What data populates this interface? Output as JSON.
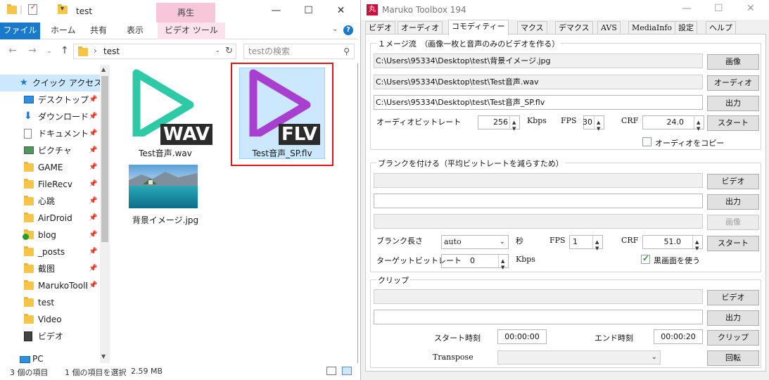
{
  "explorer": {
    "title": "test",
    "ribbon_context_tab": "再生",
    "tabs": [
      "ファイル",
      "ホーム",
      "共有",
      "表示",
      "ビデオ ツール"
    ],
    "address_path": "test",
    "search_placeholder": "testの検索",
    "nav": {
      "quick_access": "クイック アクセス",
      "items": [
        {
          "label": "デスクトップ",
          "icon": "desktop-icon",
          "pinned": true
        },
        {
          "label": "ダウンロード",
          "icon": "download-icon",
          "pinned": true
        },
        {
          "label": "ドキュメント",
          "icon": "document-icon",
          "pinned": true
        },
        {
          "label": "ピクチャ",
          "icon": "pictures-icon",
          "pinned": true
        },
        {
          "label": "GAME",
          "icon": "folder-icon",
          "pinned": true
        },
        {
          "label": "FileRecv",
          "icon": "folder-icon",
          "pinned": true
        },
        {
          "label": "心跳",
          "icon": "folder-icon",
          "pinned": true
        },
        {
          "label": "AirDroid",
          "icon": "folder-icon",
          "pinned": true
        },
        {
          "label": "blog",
          "icon": "folder-icon",
          "pinned": true
        },
        {
          "label": "_posts",
          "icon": "folder-icon",
          "pinned": true
        },
        {
          "label": "截图",
          "icon": "folder-icon",
          "pinned": true
        },
        {
          "label": "MarukoToolB",
          "icon": "folder-icon",
          "pinned": true
        },
        {
          "label": "test",
          "icon": "folder-icon",
          "pinned": false
        },
        {
          "label": "Video",
          "icon": "folder-icon",
          "pinned": false
        },
        {
          "label": "ビデオ",
          "icon": "video-folder-icon",
          "pinned": false
        }
      ],
      "pc": "PC"
    },
    "files": [
      {
        "name": "Test音声.wav",
        "badge": "WAV",
        "color": "#2ec9a7"
      },
      {
        "name": "Test音声_SP.flv",
        "badge": "FLV",
        "color": "#a93fd1",
        "selected": true
      },
      {
        "name": "背景イメージ.jpg",
        "badge": "",
        "color": ""
      }
    ],
    "status": {
      "count": "3 個の項目",
      "selection": "1 個の項目を選択",
      "size": "2.59 MB"
    }
  },
  "maruko": {
    "title": "Maruko Toolbox 194",
    "logo": "丸",
    "tabs": [
      "ビデオ",
      "オーディオ",
      "コモディティー",
      "マクス",
      "デマクス",
      "AVS",
      "MediaInfo",
      "設定",
      "ヘルプ"
    ],
    "active_tab": "コモディティー",
    "image_stream": {
      "title": "１メージ流　（画像一枚と音声のみのビデオを作る）",
      "image_path": "C:\\Users\\95334\\Desktop\\test\\背景イメージ.jpg",
      "audio_path": "C:\\Users\\95334\\Desktop\\test\\Test音声.wav",
      "output_path": "C:\\Users\\95334\\Desktop\\test\\Test音声_SP.flv",
      "btn_image": "画像",
      "btn_audio": "オーディオ",
      "btn_output": "出力",
      "btn_start": "スタート",
      "bitrate_label": "オーディオビットレート",
      "bitrate": "256",
      "kbps": "Kbps",
      "fps_label": "FPS",
      "fps": "30",
      "crf_label": "CRF",
      "crf": "24.0",
      "copy_audio": "オーディオをコピー",
      "copy_audio_checked": false
    },
    "blank": {
      "title": "ブランクを付ける（平均ビットレートを減らすため）",
      "btn_video": "ビデオ",
      "btn_output": "出力",
      "btn_image": "画像",
      "btn_start": "スタート",
      "length_label": "ブランク長さ",
      "length": "auto",
      "sec": "秒",
      "fps_label": "FPS",
      "fps": "1",
      "crf_label": "CRF",
      "crf": "51.0",
      "target_label": "ターゲットビットレート",
      "target": "0",
      "kbps": "Kbps",
      "black_label": "黒画面を使う",
      "black_checked": true
    },
    "clip": {
      "title": "クリップ",
      "btn_video": "ビデオ",
      "btn_output": "出力",
      "btn_clip": "クリップ",
      "btn_rotate": "回転",
      "start_label": "スタート時刻",
      "start_time": "00:00:00",
      "end_label": "エンド時刻",
      "end_time": "00:00:20",
      "transpose_label": "Transpose"
    }
  }
}
